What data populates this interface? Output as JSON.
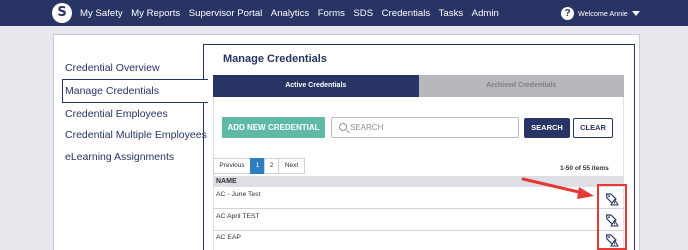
{
  "nav": {
    "logo_letter": "S",
    "links": [
      "My Safety",
      "My Reports",
      "Supervisor Portal",
      "Analytics",
      "Forms",
      "SDS",
      "Credentials",
      "Tasks",
      "Admin"
    ],
    "welcome": "Welcome Annie",
    "help_symbol": "?"
  },
  "sidebar": {
    "items": [
      {
        "label": "Credential Overview"
      },
      {
        "label": "Manage Credentials"
      },
      {
        "label": "Credential Employees"
      },
      {
        "label": "Credential Multiple Employees"
      },
      {
        "label": "eLearning Assignments"
      }
    ],
    "active_index": 1
  },
  "main": {
    "title": "Manage Credentials",
    "tabs": [
      {
        "label": "Active Credentials",
        "active": true
      },
      {
        "label": "Archived Credentials",
        "active": false
      }
    ],
    "add_button": "ADD NEW CREDENTIAL",
    "search": {
      "placeholder": "SEARCH",
      "value": ""
    },
    "search_button": "SEARCH",
    "clear_button": "CLEAR",
    "pagination": {
      "prev": "Previous",
      "pages": [
        "1",
        "2"
      ],
      "current": "1",
      "next": "Next"
    },
    "count_text": "1-50 of 55 items",
    "table": {
      "header": "NAME",
      "rows": [
        {
          "name": "AC - June Test",
          "action_icon": "archive-tag-icon"
        },
        {
          "name": "AC April TEST",
          "action_icon": "archive-tag-icon"
        },
        {
          "name": "AC EAP",
          "action_icon": "archive-tag-icon"
        }
      ]
    }
  },
  "colors": {
    "navy": "#283464",
    "teal": "#5eb9a5",
    "tab_inactive": "#b7b8bb",
    "pager_active": "#2e7fc1",
    "annotation_red": "#e53935"
  }
}
